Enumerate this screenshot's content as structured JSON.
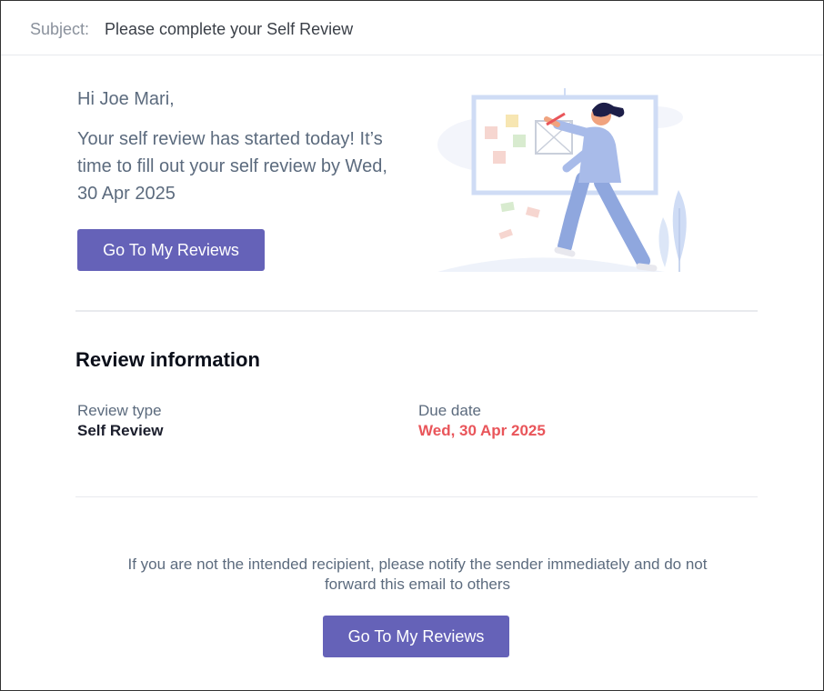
{
  "subject": {
    "label": "Subject:",
    "text": "Please complete your Self Review"
  },
  "email": {
    "greeting": "Hi Joe Mari,",
    "intro": "Your self review has started today! It’s time to fill out your self review by Wed, 30 Apr 2025",
    "cta_label": "Go To My Reviews"
  },
  "review_info": {
    "title": "Review information",
    "type_label": "Review type",
    "type_value": "Self Review",
    "due_label": "Due date",
    "due_value": "Wed, 30 Apr 2025"
  },
  "footer": {
    "disclaimer": "If you are not the intended recipient, please notify the sender immediately and do not forward this email to others",
    "cta_label": "Go To My Reviews"
  },
  "colors": {
    "button": "#6562b8",
    "due_date": "#e9555a",
    "body_text": "#5c6b7e"
  },
  "illustration": {
    "icon": "person-drawing-on-whiteboard-illustration"
  }
}
